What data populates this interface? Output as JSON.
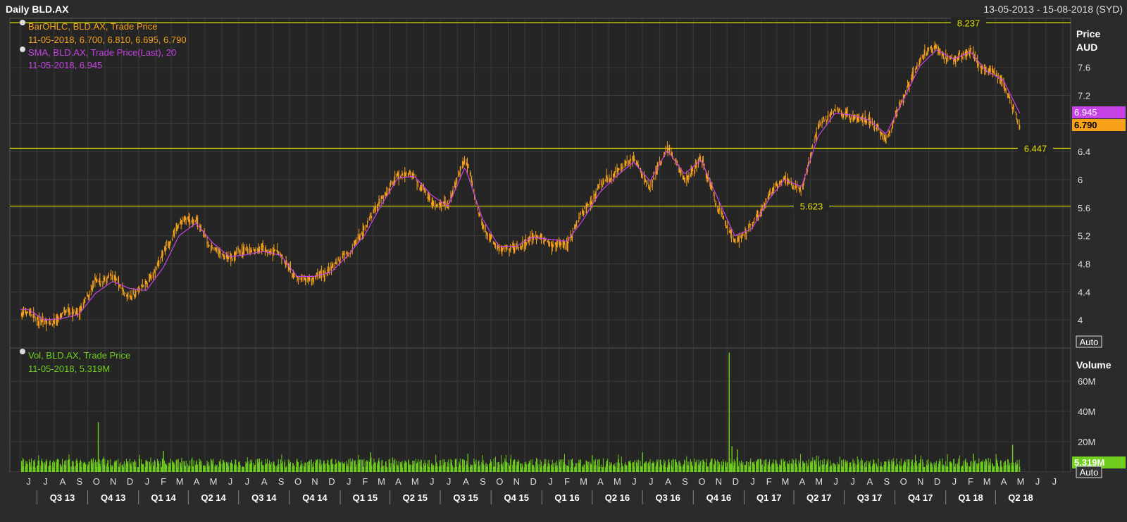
{
  "header": {
    "title": "Daily BLD.AX",
    "date_range": "13-05-2013 - 15-08-2018 (SYD)"
  },
  "colors": {
    "background": "#2b2b2b",
    "plot_background": "#252525",
    "grid": "#3a3a3a",
    "price_bars": "#f7a11a",
    "sma_line": "#c642e6",
    "volume": "#6fce1e",
    "reference_lines": "#e2e000",
    "text": "#dddddd"
  },
  "chart_data": [
    {
      "type": "bar",
      "subtype": "ohlc",
      "legend": [
        {
          "label": "BarOHLC, BLD.AX, Trade Price",
          "value": "11-05-2018, 6.700, 6.810, 6.695, 6.790",
          "color": "#f7a11a"
        },
        {
          "label": "SMA, BLD.AX, Trade Price(Last),  20",
          "value": "11-05-2018, 6.945",
          "color": "#c642e6"
        }
      ],
      "ylabel": "Price",
      "yunit": "AUD",
      "ylim": [
        3.6,
        8.3
      ],
      "yticks": [
        4,
        4.4,
        4.8,
        5.2,
        5.6,
        6,
        6.4,
        6.8,
        7.2,
        7.6
      ],
      "ytick_labels": [
        "4",
        "4.4",
        "4.8",
        "5.2",
        "5.6",
        "6",
        "6.4",
        "",
        "7.2",
        "7.6"
      ],
      "last_price": "6.790",
      "last_sma": "6.945",
      "scale_button": "Auto",
      "reference_lines": [
        {
          "value": 8.237,
          "label": "8.237"
        },
        {
          "value": 6.447,
          "label": "6.447"
        },
        {
          "value": 5.623,
          "label": "5.623"
        }
      ],
      "close_series_monthly": {
        "x": [
          "2013-06",
          "2013-07",
          "2013-08",
          "2013-09",
          "2013-10",
          "2013-11",
          "2013-12",
          "2014-01",
          "2014-02",
          "2014-03",
          "2014-04",
          "2014-05",
          "2014-06",
          "2014-07",
          "2014-08",
          "2014-09",
          "2014-10",
          "2014-11",
          "2014-12",
          "2015-01",
          "2015-02",
          "2015-03",
          "2015-04",
          "2015-05",
          "2015-06",
          "2015-07",
          "2015-08",
          "2015-09",
          "2015-10",
          "2015-11",
          "2015-12",
          "2016-01",
          "2016-02",
          "2016-03",
          "2016-04",
          "2016-05",
          "2016-06",
          "2016-07",
          "2016-08",
          "2016-09",
          "2016-10",
          "2016-11",
          "2016-12",
          "2017-01",
          "2017-02",
          "2017-03",
          "2017-04",
          "2017-05",
          "2017-06",
          "2017-07",
          "2017-08",
          "2017-09",
          "2017-10",
          "2017-11",
          "2017-12",
          "2018-01",
          "2018-02",
          "2018-03",
          "2018-04",
          "2018-05"
        ],
        "values": [
          4.1,
          3.95,
          4.05,
          4.1,
          4.5,
          4.6,
          4.35,
          4.45,
          4.95,
          5.35,
          5.45,
          5.0,
          4.85,
          4.95,
          5.0,
          4.9,
          4.55,
          4.65,
          4.7,
          5.0,
          5.3,
          5.7,
          6.1,
          6.05,
          5.7,
          5.6,
          6.3,
          5.3,
          5.0,
          5.05,
          5.2,
          5.15,
          5.1,
          5.5,
          5.9,
          6.1,
          6.3,
          5.9,
          6.5,
          6.0,
          6.3,
          5.6,
          5.1,
          5.35,
          5.8,
          6.05,
          5.85,
          6.8,
          7.0,
          6.9,
          6.85,
          6.6,
          7.2,
          7.7,
          7.9,
          7.7,
          7.85,
          7.5,
          7.4,
          6.79
        ]
      },
      "sma_series_monthly": {
        "x": [
          "2013-06",
          "2013-07",
          "2013-08",
          "2013-09",
          "2013-10",
          "2013-11",
          "2013-12",
          "2014-01",
          "2014-02",
          "2014-03",
          "2014-04",
          "2014-05",
          "2014-06",
          "2014-07",
          "2014-08",
          "2014-09",
          "2014-10",
          "2014-11",
          "2014-12",
          "2015-01",
          "2015-02",
          "2015-03",
          "2015-04",
          "2015-05",
          "2015-06",
          "2015-07",
          "2015-08",
          "2015-09",
          "2015-10",
          "2015-11",
          "2015-12",
          "2016-01",
          "2016-02",
          "2016-03",
          "2016-04",
          "2016-05",
          "2016-06",
          "2016-07",
          "2016-08",
          "2016-09",
          "2016-10",
          "2016-11",
          "2016-12",
          "2017-01",
          "2017-02",
          "2017-03",
          "2017-04",
          "2017-05",
          "2017-06",
          "2017-07",
          "2017-08",
          "2017-09",
          "2017-10",
          "2017-11",
          "2017-12",
          "2018-01",
          "2018-02",
          "2018-03",
          "2018-04",
          "2018-05"
        ],
        "values": [
          4.15,
          4.0,
          4.02,
          4.08,
          4.38,
          4.55,
          4.45,
          4.42,
          4.75,
          5.2,
          5.38,
          5.1,
          4.9,
          4.93,
          4.98,
          4.92,
          4.62,
          4.62,
          4.68,
          4.92,
          5.22,
          5.62,
          6.02,
          6.05,
          5.78,
          5.62,
          6.18,
          5.45,
          5.05,
          5.05,
          5.18,
          5.15,
          5.12,
          5.42,
          5.82,
          6.05,
          6.25,
          5.98,
          6.42,
          6.08,
          6.28,
          5.72,
          5.2,
          5.3,
          5.72,
          6.0,
          5.9,
          6.62,
          6.95,
          6.92,
          6.85,
          6.65,
          7.12,
          7.62,
          7.85,
          7.72,
          7.82,
          7.55,
          7.42,
          6.945
        ]
      }
    },
    {
      "type": "bar",
      "subtype": "volume",
      "legend": [
        {
          "label": "Vol, BLD.AX, Trade Price",
          "value": "11-05-2018, 5.319M",
          "color": "#6fce1e"
        }
      ],
      "ylabel": "Volume",
      "ylim": [
        0,
        82
      ],
      "yticks": [
        20,
        40,
        60
      ],
      "ytick_labels": [
        "20M",
        "40M",
        "60M"
      ],
      "last_value": "5.319M",
      "scale_button": "Auto",
      "unit": "M",
      "typical_volume_range": [
        3,
        9
      ],
      "spikes": [
        {
          "x": "2013-10-20",
          "value": 33
        },
        {
          "x": "2016-12-05",
          "value": 79
        },
        {
          "x": "2016-12-05",
          "value": 32
        },
        {
          "x": "2016-12-10",
          "value": 17
        },
        {
          "x": "2018-05-02",
          "value": 18
        },
        {
          "x": "2015-08-20",
          "value": 12
        },
        {
          "x": "2016-07-01",
          "value": 13
        },
        {
          "x": "2016-12-20",
          "value": 15
        },
        {
          "x": "2014-02-15",
          "value": 14
        },
        {
          "x": "2015-02-25",
          "value": 13
        },
        {
          "x": "2016-04-01",
          "value": 11
        },
        {
          "x": "2018-02-20",
          "value": 12
        }
      ]
    }
  ],
  "x_axis": {
    "start": "2013-05-13",
    "end": "2018-08-15",
    "month_letters": [
      "J",
      "J",
      "A",
      "S",
      "O",
      "N",
      "D",
      "J",
      "F",
      "M",
      "A",
      "M",
      "J",
      "J",
      "A",
      "S",
      "O",
      "N",
      "D",
      "J",
      "F",
      "M",
      "A",
      "M",
      "J",
      "J",
      "A",
      "S",
      "O",
      "N",
      "D",
      "J",
      "F",
      "M",
      "A",
      "M",
      "J",
      "J",
      "A",
      "S",
      "O",
      "N",
      "D",
      "J",
      "F",
      "M",
      "A",
      "M",
      "J",
      "J",
      "A",
      "S",
      "O",
      "N",
      "D",
      "J",
      "F",
      "M",
      "A",
      "M",
      "J",
      "J",
      "A"
    ],
    "quarters": [
      "Q3 13",
      "Q4 13",
      "Q1 14",
      "Q2 14",
      "Q3 14",
      "Q4 14",
      "Q1 15",
      "Q2 15",
      "Q3 15",
      "Q4 15",
      "Q1 16",
      "Q2 16",
      "Q3 16",
      "Q4 16",
      "Q1 17",
      "Q2 17",
      "Q3 17",
      "Q4 17",
      "Q1 18",
      "Q2 18"
    ]
  }
}
